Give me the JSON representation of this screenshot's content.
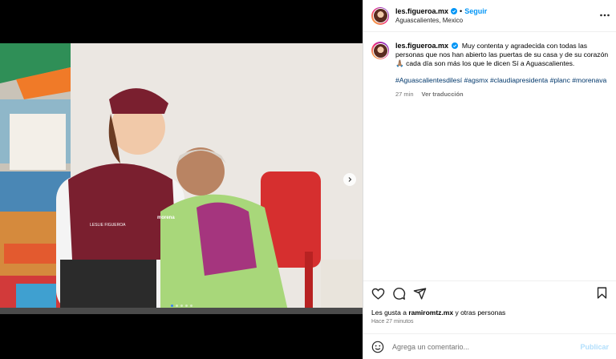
{
  "post": {
    "username": "les.figueroa.mx",
    "separator": "•",
    "follow_label": "Seguir",
    "location": "Aguascalientes, Mexico",
    "caption_text": "Muy contenta y agradecida con todas las personas que nos han abierto las puertas de su casa y de su corazón 🙏🏽 cada día son más los que le dicen Sí a Aguascalientes.",
    "hashtags": [
      "#Aguascalientesdilesí",
      "#agsmx",
      "#claudiapresidenta",
      "#planc",
      "#morenava"
    ],
    "caption_age": "27 min",
    "translate_label": "Ver traducción",
    "likes_prefix": "Les gusta a",
    "likes_user": "ramiromtz.mx",
    "likes_suffix": "y otras personas",
    "posted_ago": "Hace 27 minutos",
    "comment_placeholder": "Agrega un comentario...",
    "publish_label": "Publicar"
  },
  "photo": {
    "vest_name": "LESLIE FIGUEROA",
    "vest_party": "morena",
    "carousel_total": 5,
    "carousel_active": 1
  },
  "icons": {
    "verified": "verified-badge-icon",
    "more": "more-options-icon",
    "like": "heart-icon",
    "comment": "comment-icon",
    "share": "share-icon",
    "save": "bookmark-icon",
    "emoji": "emoji-icon",
    "next": "chevron-right-icon"
  },
  "colors": {
    "accent": "#0095f6",
    "link": "#00376b",
    "muted": "#737373",
    "publish_disabled": "#b2dffc"
  }
}
